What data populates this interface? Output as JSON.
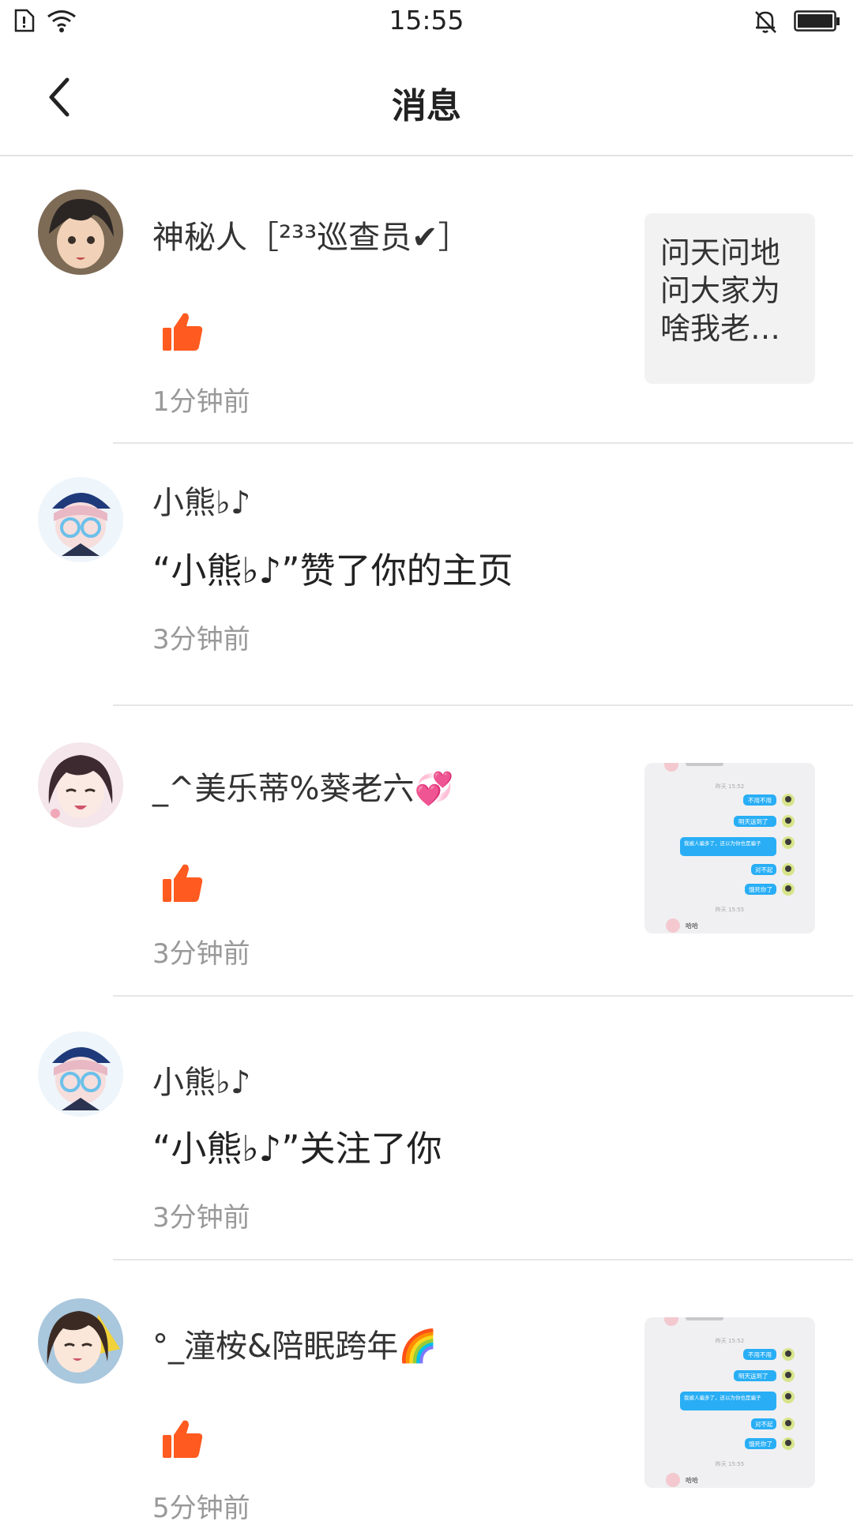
{
  "status_bar": {
    "time": "15:55"
  },
  "header": {
    "title": "消息"
  },
  "messages": [
    {
      "username": "神秘人［²³³巡查员✔］",
      "time": "1分钟前",
      "preview_text": "问天问地问大家为啥我老…"
    },
    {
      "username": "小熊♭♪",
      "text": "“小熊♭♪”赞了你的主页",
      "time": "3分钟前"
    },
    {
      "username": "_^美乐蒂%葵老六💞",
      "time": "3分钟前"
    },
    {
      "username": "小熊♭♪",
      "text": "“小熊♭♪”关注了你",
      "time": "3分钟前"
    },
    {
      "username": "°_潼桉&陪眠跨年🌈",
      "time": "5分钟前"
    }
  ],
  "chat_preview": {
    "rows": [
      "不用不用",
      "明天送到了",
      "我被人骗多了，还以为你也是骗子",
      "对不起",
      "饿死你了"
    ],
    "date": "昨天 15:52",
    "date_bottom": "昨天 15:55",
    "footer_name": "哈哈"
  },
  "colors": {
    "accent": "#ff5a1f",
    "chat_bubble": "#29aef5"
  }
}
